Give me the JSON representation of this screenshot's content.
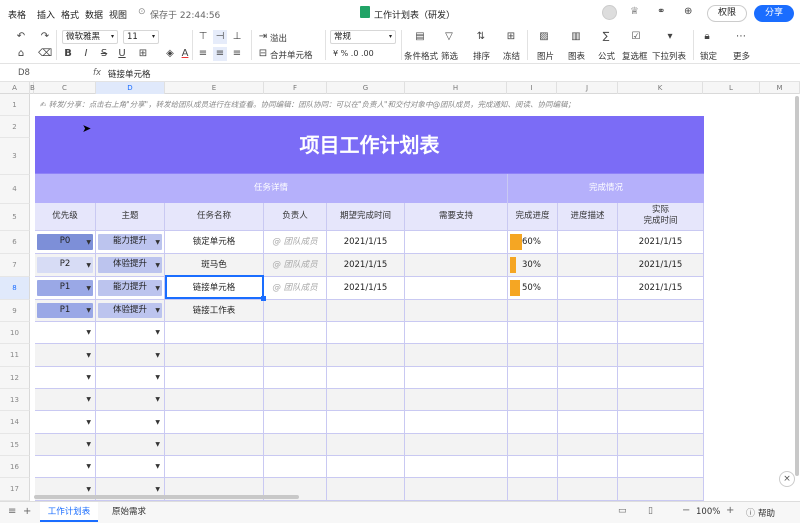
{
  "menu": [
    "表格",
    "插入",
    "格式",
    "数据",
    "视图"
  ],
  "save_status": "保存于 22:44:56",
  "doc_title": "工作计划表（研发）",
  "buttons": {
    "permissions": "权限",
    "share": "分享"
  },
  "toolbar": {
    "font_name": "微软雅黑",
    "font_size": "11",
    "overflow": "溢出",
    "merge": "合并单元格",
    "number_format": "常规",
    "cond_format": "条件格式",
    "filter": "筛选",
    "sort": "排序",
    "freeze": "冻结",
    "image": "图片",
    "chart": "图表",
    "formula": "公式",
    "checkbox": "复选框",
    "dropdown": "下拉列表",
    "lock": "锁定",
    "more": "更多"
  },
  "formula_bar": {
    "cell_ref": "D8",
    "fx": "fx",
    "content": "链接单元格"
  },
  "columns": [
    "A",
    "B",
    "C",
    "D",
    "E",
    "F",
    "G",
    "H",
    "I",
    "J",
    "K",
    "L",
    "M",
    "N"
  ],
  "rows": [
    "1",
    "2",
    "3",
    "4",
    "5",
    "6",
    "7",
    "8",
    "9",
    "10",
    "11",
    "12",
    "13",
    "14",
    "15",
    "16",
    "17"
  ],
  "sheet": {
    "tip": "✍ 转发/分享：点击右上角\"分享\"，转发给团队成员进行在线查看。协同编辑：团队协同：可以在\"负责人\"和交付对象中@团队成员，完成通知、阅读、协同编辑；",
    "title": "项目工作计划表",
    "section_task": "任务详情",
    "section_done": "完成情况",
    "headers": [
      "优先级",
      "主题",
      "任务名称",
      "负责人",
      "期望完成时间",
      "需要支持",
      "完成进度",
      "进度描述",
      "实际\n完成时间"
    ],
    "tasks": [
      {
        "priority": "P0",
        "topic": "能力提升",
        "name": "锁定单元格",
        "owner": "@ 团队成员",
        "expected": "2021/1/15",
        "progress": "60%",
        "progress_value": 0.6,
        "actual": "2021/1/15"
      },
      {
        "priority": "P2",
        "topic": "体验提升",
        "name": "斑马色",
        "owner": "@ 团队成员",
        "expected": "2021/1/15",
        "progress": "30%",
        "progress_value": 0.3,
        "actual": "2021/1/15"
      },
      {
        "priority": "P1",
        "topic": "能力提升",
        "name": "链接单元格",
        "owner": "@ 团队成员",
        "expected": "2021/1/15",
        "progress": "50%",
        "progress_value": 0.5,
        "actual": "2021/1/15"
      },
      {
        "priority": "P1",
        "topic": "体验提升",
        "name": "链接工作表",
        "owner": "",
        "expected": "",
        "progress": "",
        "progress_value": 0,
        "actual": ""
      }
    ]
  },
  "tabs": [
    "工作计划表",
    "原始需求"
  ],
  "zoom": "100%",
  "help": "帮助",
  "colors": {
    "banner": "#7b6cf6",
    "section": "#b5b0fb",
    "header": "#e6e6fb",
    "accent": "#1a6dff",
    "progress": "#f5a623",
    "p0": "#7d8fd8",
    "p2": "#d7dcf5",
    "p1": "#9aa8e6",
    "topic": "#bcc4ee"
  }
}
